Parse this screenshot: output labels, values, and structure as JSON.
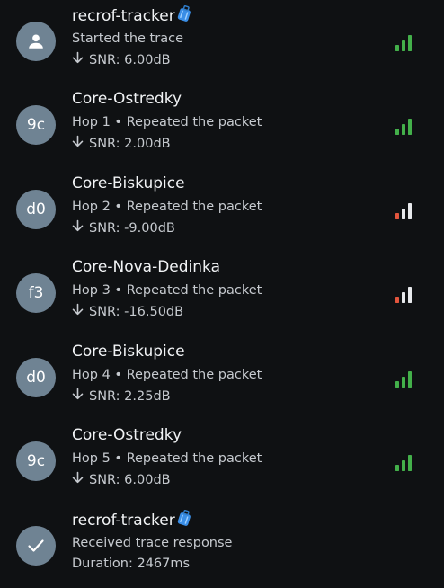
{
  "colors": {
    "background": "#0f1113",
    "avatar": "#6f8393",
    "signal_good": "#43b04a",
    "signal_bad": "#e2553d",
    "signal_empty": "#e7e9ec"
  },
  "hops": [
    {
      "avatar_icon": "person-icon",
      "avatar_text": "",
      "name": "recrof-tracker",
      "badge_icon": "luggage-icon",
      "subtitle": "Started the trace",
      "meta_icon": "arrow-down-icon",
      "meta": "SNR: 6.00dB",
      "signal_icon": "signal-bars-icon",
      "signal_level": 3,
      "signal_color": "#43b04a"
    },
    {
      "avatar_icon": "",
      "avatar_text": "9c",
      "name": "Core-Ostredky",
      "subtitle": "Hop 1 • Repeated the packet",
      "meta_icon": "arrow-down-icon",
      "meta": "SNR: 2.00dB",
      "signal_icon": "signal-bars-icon",
      "signal_level": 3,
      "signal_color": "#43b04a"
    },
    {
      "avatar_icon": "",
      "avatar_text": "d0",
      "name": "Core-Biskupice",
      "subtitle": "Hop 2 • Repeated the packet",
      "meta_icon": "arrow-down-icon",
      "meta": "SNR: -9.00dB",
      "signal_icon": "signal-bars-icon",
      "signal_level": 1,
      "signal_color": "#e2553d"
    },
    {
      "avatar_icon": "",
      "avatar_text": "f3",
      "name": "Core-Nova-Dedinka",
      "subtitle": "Hop 3 • Repeated the packet",
      "meta_icon": "arrow-down-icon",
      "meta": "SNR: -16.50dB",
      "signal_icon": "signal-bars-icon",
      "signal_level": 1,
      "signal_color": "#e2553d"
    },
    {
      "avatar_icon": "",
      "avatar_text": "d0",
      "name": "Core-Biskupice",
      "subtitle": "Hop 4 • Repeated the packet",
      "meta_icon": "arrow-down-icon",
      "meta": "SNR: 2.25dB",
      "signal_icon": "signal-bars-icon",
      "signal_level": 3,
      "signal_color": "#43b04a"
    },
    {
      "avatar_icon": "",
      "avatar_text": "9c",
      "name": "Core-Ostredky",
      "subtitle": "Hop 5 • Repeated the packet",
      "meta_icon": "arrow-down-icon",
      "meta": "SNR: 6.00dB",
      "signal_icon": "signal-bars-icon",
      "signal_level": 3,
      "signal_color": "#43b04a"
    },
    {
      "avatar_icon": "checkmark-icon",
      "avatar_text": "",
      "name": "recrof-tracker",
      "badge_icon": "luggage-icon",
      "subtitle": "Received trace response",
      "meta_icon": "",
      "meta": "Duration: 2467ms"
    }
  ]
}
